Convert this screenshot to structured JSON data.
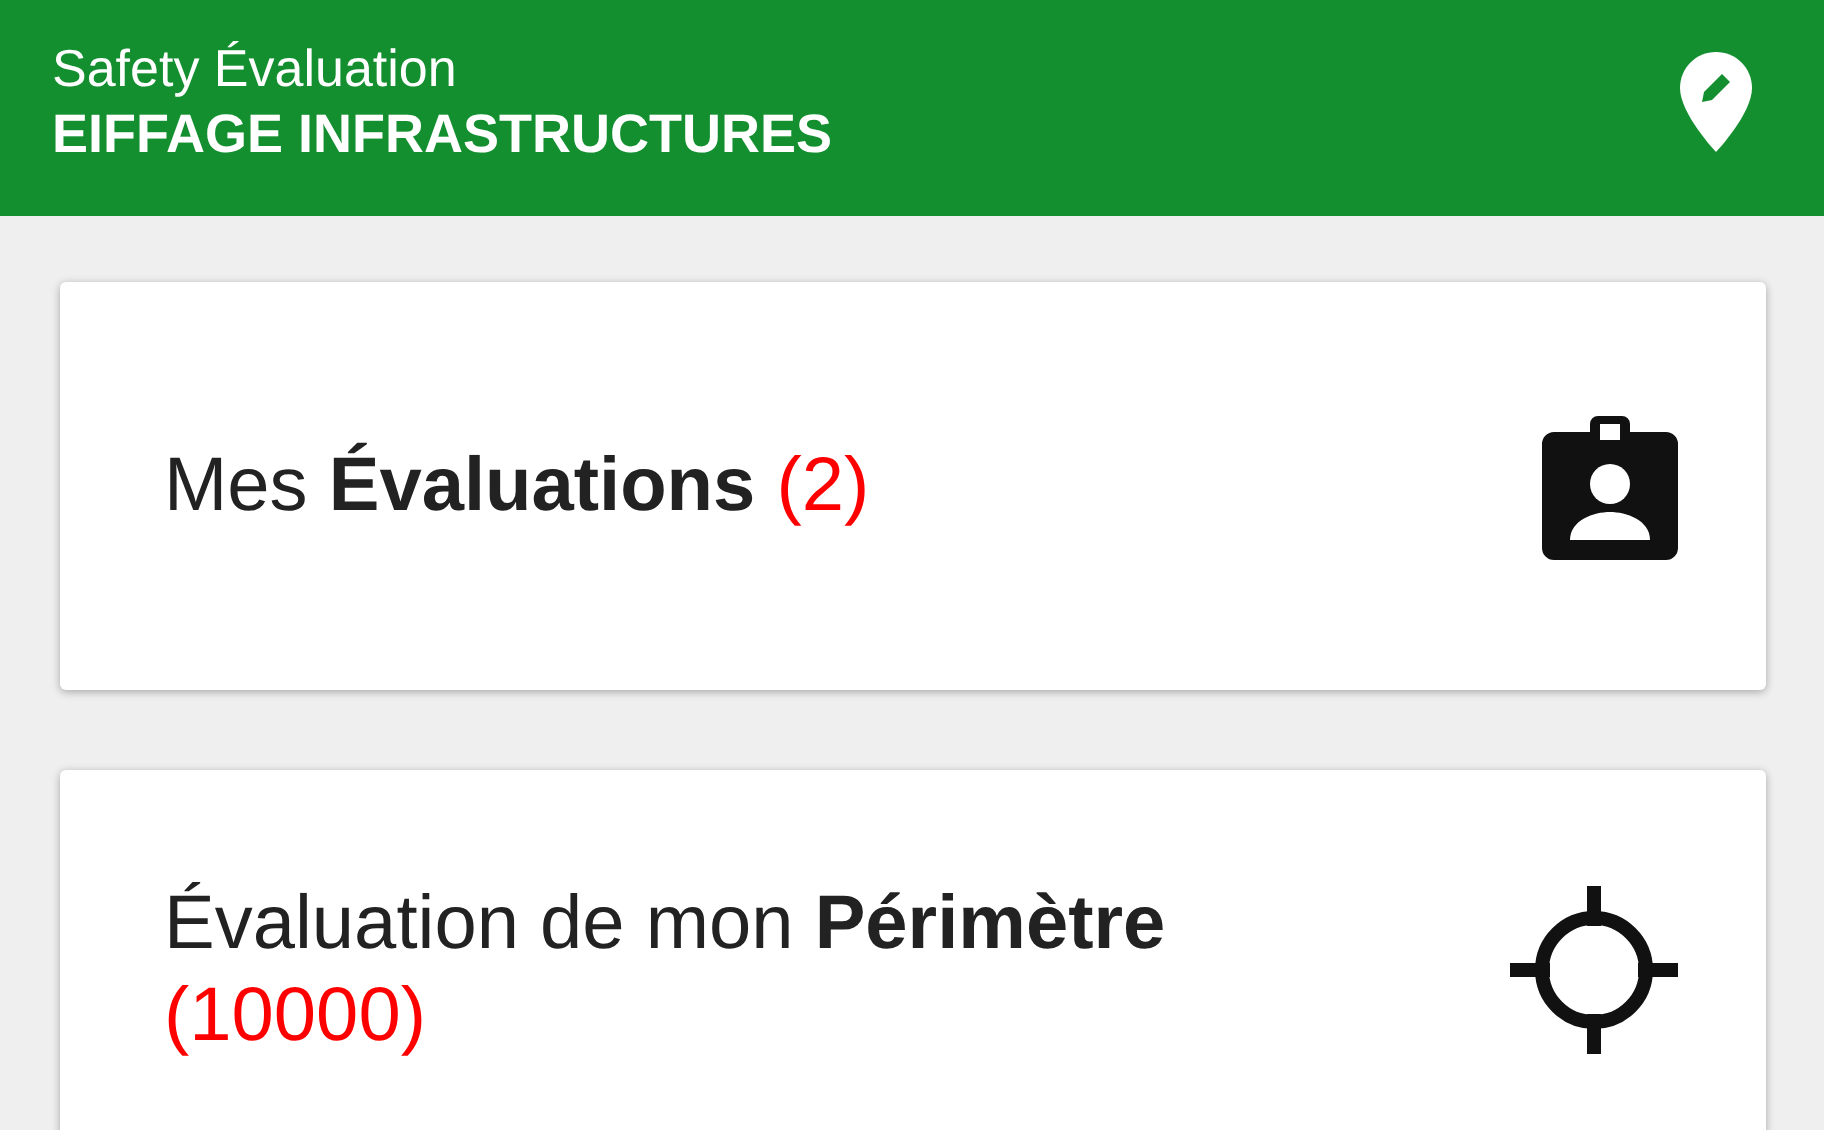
{
  "header": {
    "title": "Safety Évaluation",
    "subtitle": "EIFFAGE INFRASTRUCTURES"
  },
  "cards": [
    {
      "kind": "clipboard",
      "label": "Mes **Évaluations**",
      "count": "(2)"
    },
    {
      "kind": "crosshair",
      "label": "Évaluation de mon **Périmètre**",
      "count": "(10000)"
    }
  ]
}
